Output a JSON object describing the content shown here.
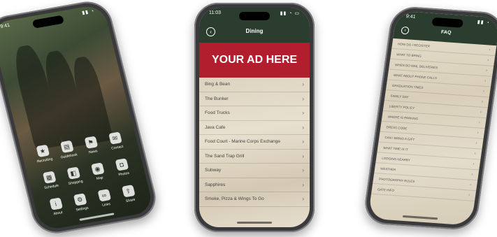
{
  "left_phone": {
    "time": "9:41",
    "icons": [
      {
        "icon": "star-icon",
        "label": "Recruiting"
      },
      {
        "icon": "book-icon",
        "label": "Guidebook"
      },
      {
        "icon": "flag-icon",
        "label": "News"
      },
      {
        "icon": "chat-icon",
        "label": "Contact"
      },
      {
        "icon": "calendar-icon",
        "label": "Schedule"
      },
      {
        "icon": "shop-icon",
        "label": "Shopping"
      },
      {
        "icon": "map-icon",
        "label": "Map"
      },
      {
        "icon": "camera-icon",
        "label": "Photos"
      },
      {
        "icon": "info-icon",
        "label": "About"
      },
      {
        "icon": "gear-icon",
        "label": "Settings"
      },
      {
        "icon": "link-icon",
        "label": "Links"
      },
      {
        "icon": "share-icon",
        "label": "Share"
      }
    ]
  },
  "center_phone": {
    "time": "11:03",
    "header_title": "Dining",
    "ad_text": "YOUR AD HERE",
    "items": [
      "Bing & Bean",
      "The Bunker",
      "Food Trucks",
      "Java Cafe",
      "Food Court - Marine Corps Exchange",
      "The Sand Trap Grill",
      "Subway",
      "Sapphires",
      "Smoke, Pizza & Wings To Go"
    ]
  },
  "right_phone": {
    "time": "9:41",
    "header_title": "FAQ",
    "items": [
      "HOW DO I REGISTER",
      "WHAT TO BRING",
      "WHEN DO MAIL DELIVERIES",
      "WHAT ABOUT PHONE CALLS",
      "GRADUATION TIMES",
      "FAMILY DAY",
      "LIBERTY POLICY",
      "WHERE IS PARKING",
      "DRESS CODE",
      "CAN I BRING A GIFT",
      "WHAT TIME IS IT",
      "LODGING NEARBY",
      "WEATHER",
      "PHOTOGRAPHY RULES",
      "GATE INFO"
    ]
  }
}
